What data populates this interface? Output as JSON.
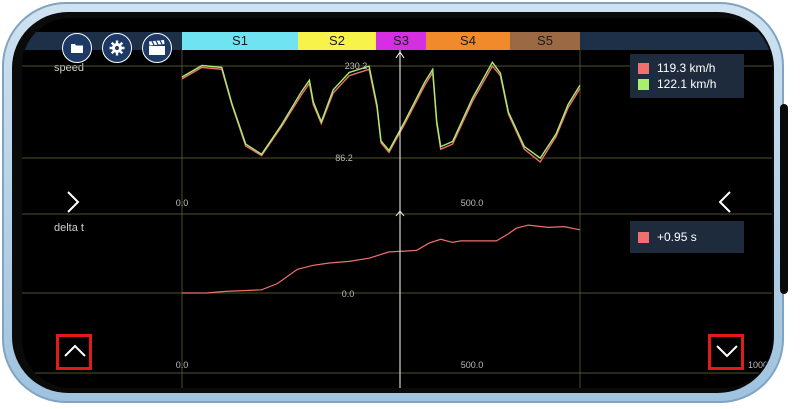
{
  "sectors": [
    "S1",
    "S2",
    "S3",
    "S4",
    "S5"
  ],
  "toolbar": {
    "folder_icon": "folder-icon",
    "settings_icon": "gear-icon",
    "video_icon": "clapperboard-icon"
  },
  "speed_panel": {
    "label": "speed",
    "y_max_label": "230.2",
    "y_min_label": "86.2",
    "x_start_label": "0.0",
    "x_mid_label": "500.0",
    "legend": [
      {
        "value": "119.3 km/h",
        "color": "#f07070"
      },
      {
        "value": "122.1 km/h",
        "color": "#a6f06a"
      }
    ]
  },
  "delta_panel": {
    "label": "delta t",
    "zero_label": "0.0",
    "x_start_label": "0.0",
    "x_mid_label": "500.0",
    "x_end_label": "1000",
    "legend": [
      {
        "value": "+0.95 s",
        "color": "#f07070"
      }
    ]
  },
  "colors": {
    "lap_red": "#f07070",
    "lap_green": "#a6f06a",
    "cursor": "#ffffff",
    "highlight": "#e41919",
    "topbar": "#1d3048"
  },
  "nav": {
    "left_icon": "chevron-right-icon",
    "right_icon": "chevron-left-icon",
    "up_icon": "chevron-up-icon",
    "down_icon": "chevron-down-icon"
  },
  "chart_data": [
    {
      "type": "line",
      "title": "",
      "ylabel": "speed",
      "xlim": [
        0,
        1000
      ],
      "ylim": [
        86.2,
        230.2
      ],
      "x": [
        0,
        50,
        100,
        125,
        160,
        200,
        250,
        300,
        320,
        330,
        350,
        380,
        420,
        470,
        490,
        500,
        520,
        560,
        610,
        630,
        640,
        650,
        680,
        730,
        780,
        800,
        820,
        860,
        900,
        940,
        970,
        1000
      ],
      "series": [
        {
          "name": "119.3 km/h",
          "values": [
            210,
            228,
            225,
            170,
            105,
            90,
            135,
            185,
            203,
            170,
            140,
            188,
            215,
            225,
            165,
            110,
            95,
            140,
            200,
            220,
            140,
            100,
            108,
            175,
            230,
            215,
            155,
            100,
            80,
            120,
            165,
            195
          ]
        },
        {
          "name": "122.1 km/h",
          "values": [
            213,
            231,
            228,
            172,
            108,
            92,
            138,
            190,
            208,
            174,
            143,
            193,
            220,
            230,
            169,
            113,
            98,
            144,
            205,
            225,
            144,
            104,
            112,
            180,
            236,
            219,
            158,
            104,
            86,
            124,
            170,
            200
          ]
        }
      ]
    },
    {
      "type": "line",
      "title": "",
      "ylabel": "delta t",
      "xlim": [
        0,
        1000
      ],
      "x": [
        0,
        60,
        110,
        200,
        240,
        290,
        330,
        370,
        420,
        470,
        520,
        560,
        590,
        620,
        650,
        680,
        700,
        740,
        790,
        820,
        840,
        870,
        920,
        960,
        1000
      ],
      "series": [
        {
          "name": "+0.95 s",
          "values": [
            0.0,
            0.0,
            0.02,
            0.04,
            0.12,
            0.3,
            0.35,
            0.38,
            0.4,
            0.44,
            0.52,
            0.53,
            0.54,
            0.63,
            0.68,
            0.64,
            0.66,
            0.66,
            0.66,
            0.75,
            0.82,
            0.86,
            0.83,
            0.84,
            0.8
          ]
        }
      ]
    }
  ]
}
